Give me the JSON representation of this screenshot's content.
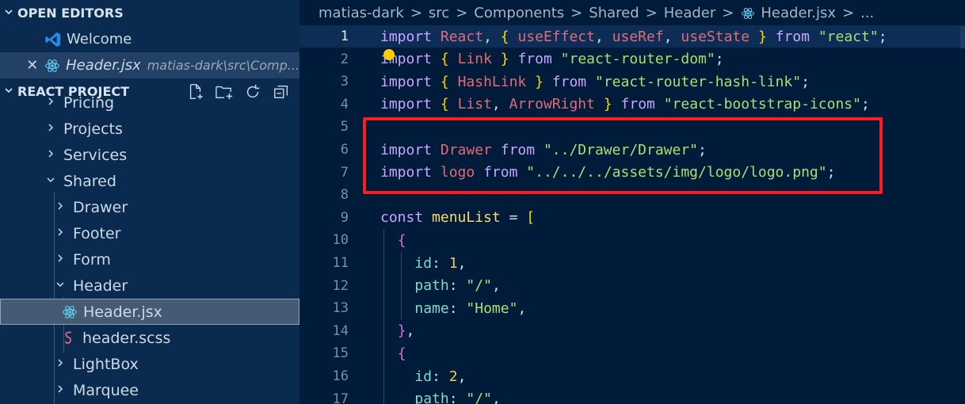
{
  "sidebar": {
    "open_editors": {
      "title": "OPEN EDITORS",
      "items": [
        {
          "name": "Welcome",
          "icon": "vscode-icon"
        },
        {
          "name": "Header.jsx",
          "path": "matias-dark\\src\\Comp...",
          "icon": "react-icon",
          "close": "✕"
        }
      ]
    },
    "project": {
      "title": "REACT PROJECT",
      "actions": [
        "new-file-icon",
        "new-folder-icon",
        "refresh-icon",
        "collapse-all-icon"
      ]
    },
    "tree": [
      {
        "label": "Pricing"
      },
      {
        "label": "Projects"
      },
      {
        "label": "Services"
      },
      {
        "label": "Shared"
      },
      {
        "label": "Drawer"
      },
      {
        "label": "Footer"
      },
      {
        "label": "Form"
      },
      {
        "label": "Header"
      },
      {
        "label": "Header.jsx"
      },
      {
        "label": "header.scss"
      },
      {
        "label": "LightBox"
      },
      {
        "label": "Marquee"
      }
    ]
  },
  "breadcrumb": {
    "parts": [
      "matias-dark",
      "src",
      "Components",
      "Shared",
      "Header",
      "Header.jsx",
      "..."
    ],
    "separator": ">"
  },
  "editor": {
    "line_numbers": [
      "1",
      "2",
      "3",
      "4",
      "5",
      "6",
      "7",
      "8",
      "9",
      "10",
      "11",
      "12",
      "13",
      "14",
      "15",
      "16",
      "17"
    ],
    "lines": [
      "import React, { useEffect, useRef, useState } from \"react\";",
      "import { Link } from \"react-router-dom\";",
      "import { HashLink } from \"react-router-hash-link\";",
      "import { List, ArrowRight } from \"react-bootstrap-icons\";",
      "",
      "import Drawer from \"../Drawer/Drawer\";",
      "import logo from \"../../../assets/img/logo/logo.png\";",
      "",
      "const menuList = [",
      "  {",
      "    id: 1,",
      "    path: \"/\",",
      "    name: \"Home\",",
      "  },",
      "  {",
      "    id: 2,",
      "    path: \"/\","
    ]
  },
  "colors": {
    "sidebar_bg": "#0a2a4f",
    "editor_bg": "#011b3a",
    "highlight_box": "#ff1c1c",
    "keyword": "#c7a7ff",
    "string": "#a5e075"
  }
}
